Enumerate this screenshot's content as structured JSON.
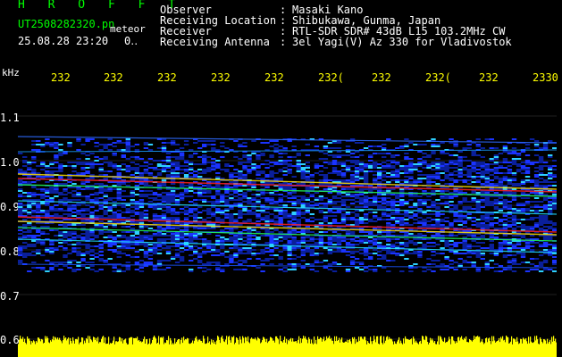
{
  "header": {
    "app_title": "H R O F F T",
    "file_name": "UT2508282320.pn",
    "file_suffix": "meteor",
    "date_time": "25.08.28 23:20",
    "status": "0․․"
  },
  "info": {
    "labels": [
      "Observer",
      "Receiving Location",
      "Receiver",
      "Receiving Antenna"
    ],
    "separator": ":",
    "values": [
      "Masaki Kano",
      "Shibukawa, Gunma, Japan",
      "RTL-SDR SDR# 43dB L15 103.2MHz CW",
      "3el Yagi(V) Az 330 for Vladivostok"
    ]
  },
  "axis": {
    "unit": "kHz",
    "y_ticks": [
      "1.1",
      "1.0",
      "0.9",
      "0.8",
      "0.7",
      "0.6"
    ],
    "x_ticks": [
      "232",
      "232",
      "232",
      "232",
      "232",
      "232(",
      "232",
      "232(",
      "232",
      "2330"
    ]
  },
  "colors": {
    "background": "#000000",
    "header_green": "#00ff00",
    "label_white": "#ffffff",
    "time_yellow": "#ffff00",
    "noise_blue": "#1a33ff",
    "signal_red": "#ff2020"
  }
}
